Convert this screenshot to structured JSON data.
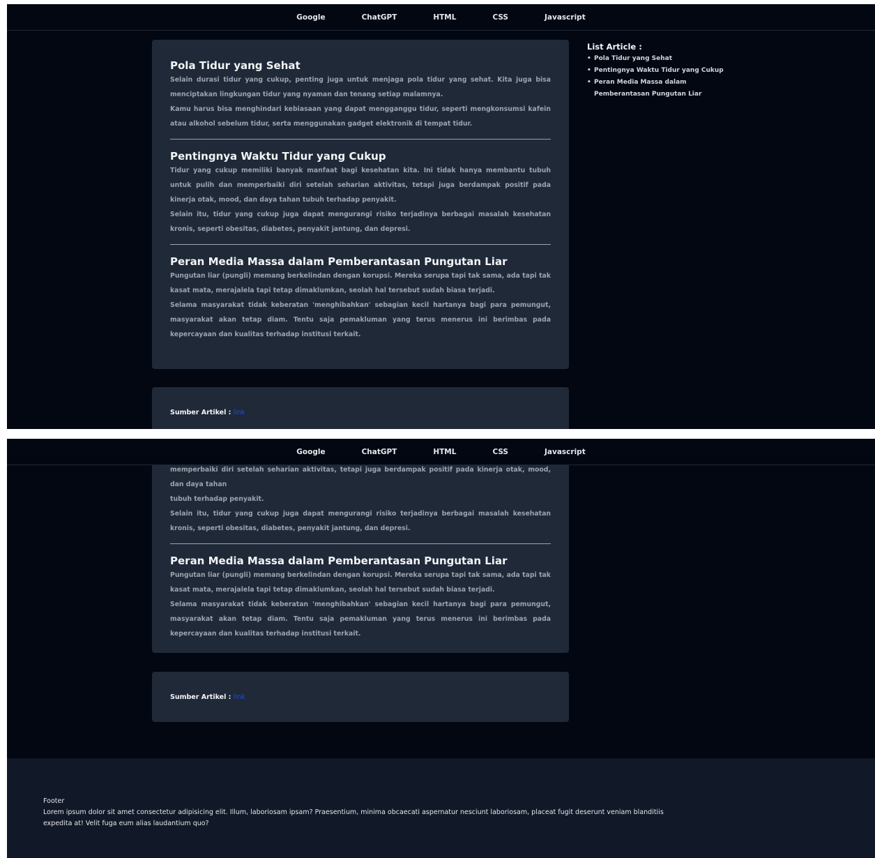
{
  "nav": [
    "Google",
    "ChatGPT",
    "HTML",
    "CSS",
    "Javascript"
  ],
  "articles": [
    {
      "title": "Pola Tidur yang Sehat",
      "paragraphs": [
        "Selain durasi tidur yang cukup, penting juga untuk menjaga pola tidur yang sehat. Kita juga bisa menciptakan lingkungan tidur yang nyaman dan tenang setiap malamnya.",
        "Kamu harus bisa menghindari kebiasaan yang dapat mengganggu tidur, seperti mengkonsumsi kafein atau alkohol sebelum tidur, serta menggunakan gadget elektronik di tempat tidur."
      ]
    },
    {
      "title": "Pentingnya Waktu Tidur yang Cukup",
      "paragraphs": [
        "Tidur yang cukup memiliki banyak manfaat bagi kesehatan kita. Ini tidak hanya membantu tubuh untuk pulih dan memperbaiki diri setelah seharian aktivitas, tetapi juga berdampak positif pada kinerja otak, mood, dan daya tahan tubuh terhadap penyakit.",
        "Selain itu, tidur yang cukup juga dapat mengurangi risiko terjadinya berbagai masalah kesehatan kronis, seperti obesitas, diabetes, penyakit jantung, dan depresi."
      ]
    },
    {
      "title": "Peran Media Massa dalam Pemberantasan Pungutan Liar",
      "paragraphs": [
        "Pungutan liar (pungli) memang berkelindan dengan korupsi. Mereka serupa tapi tak sama, ada tapi tak kasat mata, merajalela tapi tetap dimaklumkan, seolah hal tersebut sudah biasa terjadi.",
        "Selama masyarakat tidak keberatan 'menghibahkan' sebagian kecil hartanya bagi para pemungut, masyarakat akan tetap diam. Tentu saja pemakluman yang terus menerus ini berimbas pada kepercayaan dan kualitas terhadap institusi terkait."
      ]
    }
  ],
  "scrolled_view_fragment": {
    "line1": "memperbaiki diri setelah seharian aktivitas, tetapi juga berdampak positif pada kinerja otak, mood, dan daya tahan",
    "line2": "tubuh terhadap penyakit."
  },
  "source": {
    "label": "Sumber Artikel :",
    "link_text": "link"
  },
  "aside": {
    "title": "List Article :",
    "items": [
      "Pola Tidur yang Sehat",
      "Pentingnya Waktu Tidur yang Cukup",
      "Peran Media Massa dalam Pemberantasan Pungutan Liar"
    ]
  },
  "footer": {
    "title": "Footer",
    "body": "Lorem ipsum dolor sit amet consectetur adipisicing elit. Illum, laboriosam ipsam? Praesentium, minima obcaecati aspernatur nesciunt laboriosam, placeat fugit deserunt veniam blanditiis expedita at! Velit fuga eum alias laudantium quo?"
  },
  "colors": {
    "page_bg": "#030712",
    "card_bg": "#1f2937",
    "footer_bg": "#111827",
    "link": "#1d4ed8"
  }
}
